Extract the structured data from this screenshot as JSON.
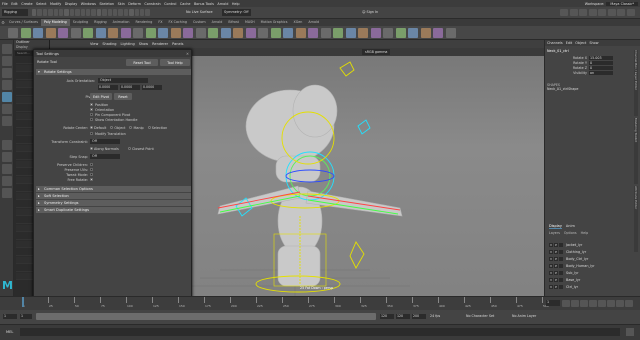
{
  "menubar": {
    "items": [
      "File",
      "Edit",
      "Create",
      "Select",
      "Modify",
      "Display",
      "Windows",
      "Skeleton",
      "Skin",
      "Deform",
      "Constrain",
      "Control",
      "Cache",
      "Bonus Tools",
      "Arnold",
      "Help"
    ],
    "workspace_label": "Workspace:",
    "workspace_value": "Maya Classic*"
  },
  "statusline": {
    "mode": "Rigging",
    "no_live_surface": "No Live Surface",
    "symmetry": "Symmetry: Off",
    "sign_in": "Sign In"
  },
  "shelf_tabs": [
    "Curves / Surfaces",
    "Poly Modeling",
    "Sculpting",
    "Rigging",
    "Animation",
    "Rendering",
    "FX",
    "FX Caching",
    "Custom",
    "Arnold",
    "Bifrost",
    "MASH",
    "Motion Graphics",
    "XGen",
    "Arnold"
  ],
  "shelf_active_index": 1,
  "viewport": {
    "menu": [
      "View",
      "Shading",
      "Lighting",
      "Show",
      "Renderer",
      "Panels"
    ],
    "colorspace": "sRGB gamma",
    "camera_label": "25 Fat Down : persp"
  },
  "outliner": {
    "title": "Outliner",
    "display_label": "Display",
    "search_placeholder": "Search..."
  },
  "tool_settings": {
    "title": "Tool Settings",
    "tool_name": "Rotate Tool",
    "reset_button": "Reset Tool",
    "help_button": "Tool Help",
    "section_rotate": "Rotate Settings",
    "axis_orientation_label": "Axis Orientation:",
    "axis_orientation_value": "Object",
    "xyz": [
      "0.0000",
      "0.0000",
      "0.0000"
    ],
    "pivot_label": "Pivot:",
    "edit_pivot": "Edit Pivot",
    "reset_pivot": "Reset",
    "pivot_checks": [
      {
        "label": "Position",
        "checked": true
      },
      {
        "label": "Orientation",
        "checked": true
      },
      {
        "label": "Pin Component Pivot",
        "checked": false
      },
      {
        "label": "Show Orientation Handle",
        "checked": false
      }
    ],
    "rotate_center_label": "Rotate Center:",
    "rotate_center_options": [
      "Default",
      "Object",
      "Manip",
      "Selection"
    ],
    "rotate_center_selected": 0,
    "modify_translation": "Modify Translation",
    "transform_constraint_label": "Transform Constraint:",
    "transform_constraint_value": "Off",
    "along_normals": "Along Normals",
    "closest_point": "Closest Point",
    "step_snap_label": "Step Snap:",
    "step_snap_value": "Off",
    "preserve_children": "Preserve Children:",
    "preserve_uvs": "Preserve UVs:",
    "tweak_mode": "Tweak Mode:",
    "free_rotate": "Free Rotate:",
    "sections": [
      "Common Selection Options",
      "Soft Selection",
      "Symmetry Settings",
      "Smart Duplicate Settings"
    ]
  },
  "channel_box": {
    "tabs": [
      "Channels",
      "Edit",
      "Object",
      "Show"
    ],
    "object_name": "Neck_01_ctrl",
    "attributes": [
      {
        "name": "Rotate X",
        "value": "15.003"
      },
      {
        "name": "Rotate Y",
        "value": "0"
      },
      {
        "name": "Rotate Z",
        "value": "0"
      },
      {
        "name": "Visibility",
        "value": "on"
      }
    ],
    "shapes_label": "SHAPES",
    "shape_name": "Neck_01_ctrlShape",
    "side_tabs": [
      "Channel Box / Layer Editor",
      "Modeling Toolkit",
      "Attribute Editor"
    ]
  },
  "layer_editor": {
    "tabs": [
      "Display",
      "Anim"
    ],
    "menu": [
      "Layers",
      "Options",
      "Help"
    ],
    "layers": [
      "Jacket_lyr",
      "Clothing_lyr",
      "Body_Ctrl_lyr",
      "Body_Human_lyr",
      "Sub_lyr",
      "Base_lyr",
      "Ctrl_lyr"
    ]
  },
  "timeline": {
    "ticks": [
      "1",
      "25",
      "50",
      "75",
      "100",
      "125",
      "150",
      "175",
      "200",
      "225",
      "250",
      "275",
      "300",
      "325",
      "350",
      "375",
      "400",
      "425",
      "450",
      "475",
      "500"
    ],
    "current_frame": "1"
  },
  "range": {
    "start": "1",
    "inner_start": "1",
    "inner_end": "120",
    "end": "120",
    "outer_end": "200",
    "fps": "24 fps",
    "character_set": "No Character Set",
    "anim_layer": "No Anim Layer"
  },
  "cmdline": {
    "lang": "MEL"
  },
  "colors": {
    "accent": "#5285a6",
    "panel": "#444444",
    "viewport_bg": "#808080",
    "anim_yellow": "#e4e000",
    "rig_cyan": "#00e5ff"
  }
}
